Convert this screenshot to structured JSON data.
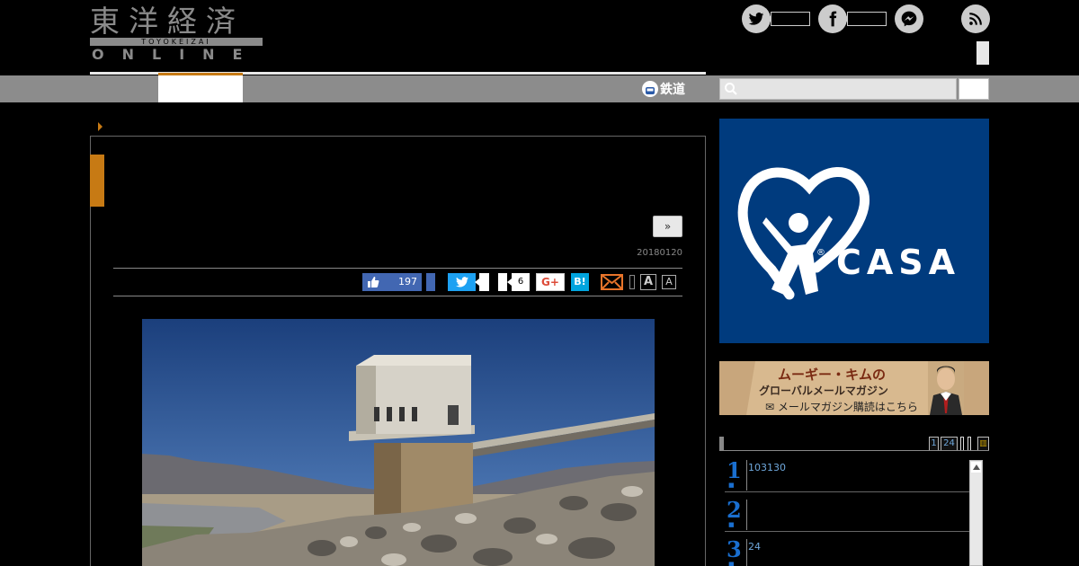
{
  "header": {
    "logo_kanji": "東洋経済",
    "logo_romaji": "TOYOKEIZAI",
    "logo_online": "ONLINE",
    "social_icons": [
      "twitter-icon",
      "facebook-icon",
      "messenger-icon",
      "rss-icon"
    ]
  },
  "nav": {
    "rail_label": "鉄道",
    "search_placeholder": ""
  },
  "article": {
    "next_label": "»",
    "date": "20180120",
    "share": {
      "fb_like_count": "197",
      "pocket_count": "6",
      "gplus_label": "G+",
      "hatena_label": "B!",
      "font_large": "A",
      "font_small": "A"
    }
  },
  "sidebar": {
    "ad_casa": {
      "brand": "CASA",
      "registered": "®"
    },
    "ad_newsletter": {
      "title": "ムーギー・キムの",
      "subtitle": "グローバルメールマガジン",
      "link": "メールマガジン購読はこちら"
    },
    "ranking": {
      "tabs": [
        "1",
        "24"
      ],
      "items": [
        {
          "rank": "1",
          "text": "103130"
        },
        {
          "rank": "2",
          "text": ""
        },
        {
          "rank": "3",
          "text": "24"
        }
      ]
    }
  },
  "colors": {
    "accent": "#c77a14",
    "nav_gray": "#8c8c8c",
    "casa_blue": "#003b7e",
    "rank_blue": "#1a6fd0"
  }
}
